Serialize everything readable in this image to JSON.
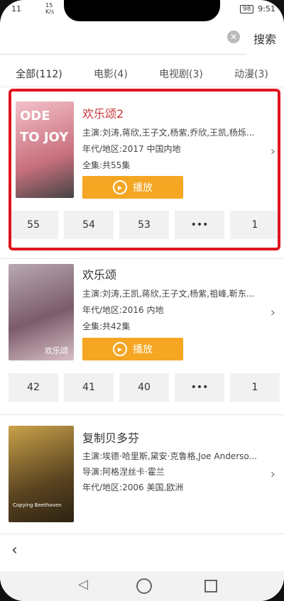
{
  "status_bar": {
    "left": "11",
    "speed_top": "15",
    "speed_bottom": "K/s",
    "battery": "98",
    "time": "9:51"
  },
  "search": {
    "placeholder": "",
    "button": "搜索"
  },
  "tabs": [
    {
      "label": "全部(112)"
    },
    {
      "label": "电影(4)"
    },
    {
      "label": "电视剧(3)"
    },
    {
      "label": "动漫(3)"
    }
  ],
  "items": [
    {
      "title": "欢乐颂2",
      "cast": "主演:刘涛,蒋欣,王子文,杨紫,乔欣,王凯,杨烁...",
      "year_area": "年代/地区:2017 中国内地",
      "episodes_text": "全集:共55集",
      "play_label": "播放",
      "poster_text": "ODE TO JOY",
      "episodes": [
        "55",
        "54",
        "53",
        "•••",
        "1"
      ]
    },
    {
      "title": "欢乐颂",
      "cast": "主演:刘涛,王凯,蒋欣,王子文,杨紫,祖峰,靳东...",
      "year_area": "年代/地区:2016 内地",
      "episodes_text": "全集:共42集",
      "play_label": "播放",
      "poster_text": "欢乐颂",
      "episodes": [
        "42",
        "41",
        "40",
        "•••",
        "1"
      ]
    },
    {
      "title": "复制贝多芬",
      "cast": "主演:埃德·哈里斯,黛安·克鲁格,Joe Anderso...",
      "director": "导演:阿格涅丝卡·霍兰",
      "year_area": "年代/地区:2006 美国,欧洲",
      "poster_text": "Copying Beethoven"
    }
  ],
  "bottom_nav": {
    "back_icon": "back-arrow-icon"
  },
  "colors": {
    "accent": "#f5a623",
    "highlight": "#e0141e",
    "title_active": "#c8353a"
  }
}
